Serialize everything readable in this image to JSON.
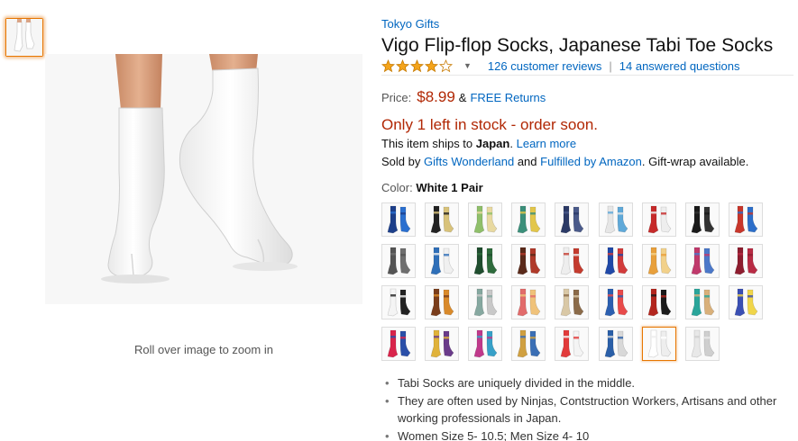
{
  "brand": "Tokyo Gifts",
  "title": "Vigo Flip-flop Socks, Japanese Tabi Toe Socks",
  "rating": {
    "stars": 4,
    "icon": "star-rating-icon"
  },
  "reviews_link": "126 customer reviews",
  "questions_link": "14 answered questions",
  "price_label": "Price:",
  "price": "$8.99",
  "amp": "&",
  "free_returns": "FREE Returns",
  "stock_msg": "Only 1 left in stock - order soon.",
  "ships": {
    "prefix": "This item ships to",
    "country": "Japan",
    "suffix": ".",
    "learn_more": "Learn more"
  },
  "sold": {
    "prefix": "Sold by",
    "seller": "Gifts Wonderland",
    "and": "and",
    "fulfilled": "Fulfilled by Amazon",
    "suffix": ". Gift-wrap available."
  },
  "color": {
    "label": "Color:",
    "value": "White 1 Pair"
  },
  "zoom_hint": "Roll over image to zoom in",
  "bullets": [
    "Tabi Socks are uniquely divided in the middle.",
    "They are often used by Ninjas, Contstruction Workers, Artisans and other working professionals in Japan.",
    "Women Size 5- 10.5; Men Size 4- 10"
  ],
  "swatches": [
    {
      "c1": "#1d3f8a",
      "c2": "#2a6fcf"
    },
    {
      "c1": "#222222",
      "c2": "#d8c27a"
    },
    {
      "c1": "#8fbf6a",
      "c2": "#e8d9a0"
    },
    {
      "c1": "#3b8f7a",
      "c2": "#e2c64a"
    },
    {
      "c1": "#2b3a66",
      "c2": "#4a5a8a"
    },
    {
      "c1": "#e6e6e6",
      "c2": "#5fa9d9"
    },
    {
      "c1": "#c62a2a",
      "c2": "#eeeeee"
    },
    {
      "c1": "#1a1a1a",
      "c2": "#333333"
    },
    {
      "c1": "#c8362b",
      "c2": "#2c6ec9"
    },
    {
      "c1": "#555555",
      "c2": "#6f6f6f"
    },
    {
      "c1": "#2f6fb8",
      "c2": "#f0f0f0"
    },
    {
      "c1": "#1f4d2e",
      "c2": "#2e6b3c"
    },
    {
      "c1": "#5a2a1a",
      "c2": "#b03a2a"
    },
    {
      "c1": "#eeeeee",
      "c2": "#c43b2e"
    },
    {
      "c1": "#2049a8",
      "c2": "#d23b3b"
    },
    {
      "c1": "#e8a03c",
      "c2": "#f2d18a"
    },
    {
      "c1": "#c03a6c",
      "c2": "#4b78c9"
    },
    {
      "c1": "#8e1d2f",
      "c2": "#b82b44"
    },
    {
      "c1": "#f4f4f4",
      "c2": "#222222"
    },
    {
      "c1": "#7a3d1b",
      "c2": "#d98a2b"
    },
    {
      "c1": "#86a8a0",
      "c2": "#c8c8c8"
    },
    {
      "c1": "#e26b6b",
      "c2": "#f0c27a"
    },
    {
      "c1": "#d9c8a6",
      "c2": "#8b6b4a"
    },
    {
      "c1": "#2b5fb0",
      "c2": "#e84a4a"
    },
    {
      "c1": "#b3261e",
      "c2": "#1a1a1a"
    },
    {
      "c1": "#2aa59a",
      "c2": "#d9b07a"
    },
    {
      "c1": "#3a4fb3",
      "c2": "#f0d54a"
    },
    {
      "c1": "#d9244b",
      "c2": "#2a4fa8"
    },
    {
      "c1": "#e0b23a",
      "c2": "#6a3b8a"
    },
    {
      "c1": "#c0398b",
      "c2": "#36a0c8"
    },
    {
      "c1": "#d0a040",
      "c2": "#3b6fb5"
    },
    {
      "c1": "#e23b3b",
      "c2": "#f4f4f4"
    },
    {
      "c1": "#2a5fa8",
      "c2": "#d8d8d8"
    },
    {
      "c1": "#ffffff",
      "c2": "#eeeeee"
    },
    {
      "c1": "#e8e8e8",
      "c2": "#cfcfcf"
    }
  ]
}
